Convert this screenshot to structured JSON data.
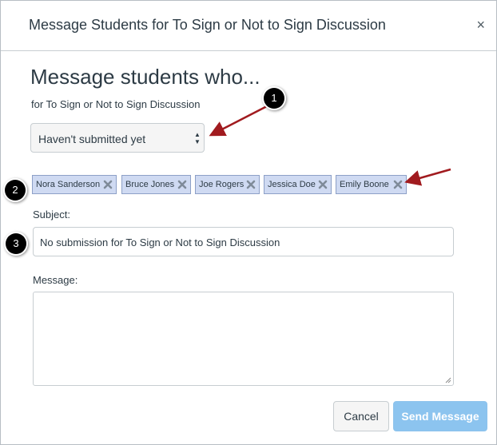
{
  "dialog": {
    "title": "Message Students for To Sign or Not to Sign Discussion",
    "close_label": "×"
  },
  "form": {
    "heading": "Message students who...",
    "subheading": "for To Sign or Not to Sign Discussion",
    "filter": {
      "selected": "Haven't submitted yet"
    },
    "recipients": [
      "Nora Sanderson",
      "Bruce Jones",
      "Joe Rogers",
      "Jessica Doe",
      "Emily Boone"
    ],
    "subject_label": "Subject:",
    "subject_value": "No submission for To Sign or Not to Sign Discussion",
    "message_label": "Message:",
    "message_value": ""
  },
  "buttons": {
    "cancel": "Cancel",
    "send": "Send Message"
  },
  "callouts": [
    "1",
    "2",
    "3"
  ],
  "colors": {
    "token_bg": "#cfdaf2",
    "send_button": "#8cc4ef",
    "arrow": "#a11b1f",
    "callout_bg": "#000000"
  },
  "icons": {
    "close": "close-icon",
    "token_remove": "remove-x-icon",
    "select": "select-arrows-icon",
    "resize": "resize-grip-icon"
  }
}
